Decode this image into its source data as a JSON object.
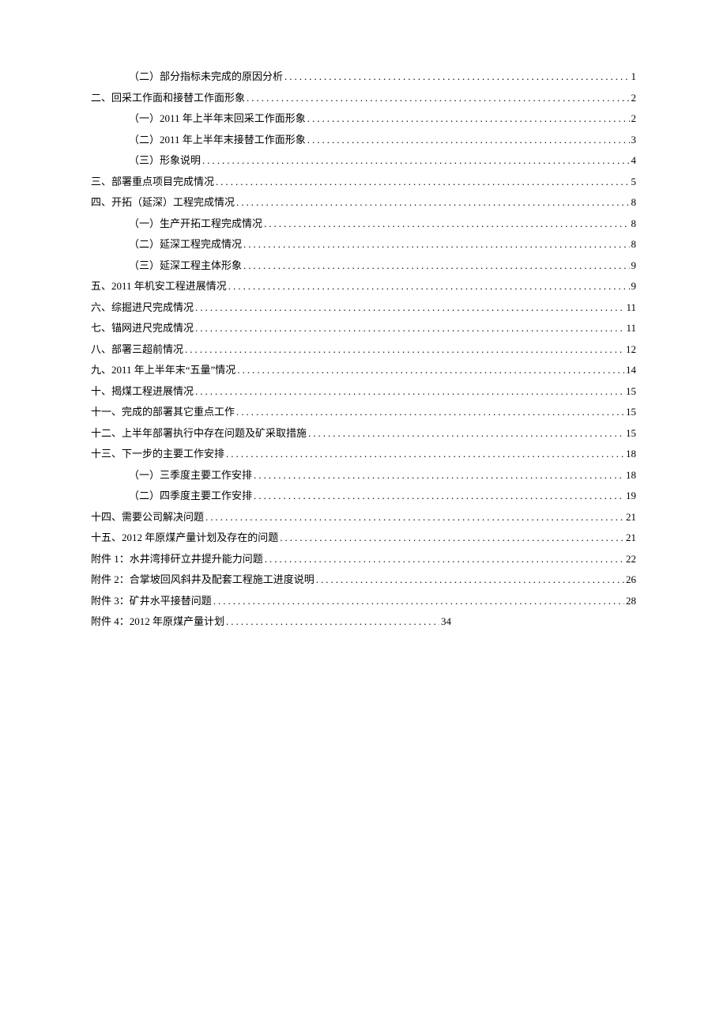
{
  "toc": [
    {
      "level": "nested",
      "title": "（二）部分指标未完成的原因分析",
      "page": "1"
    },
    {
      "level": "top",
      "title": "二、回采工作面和接替工作面形象",
      "page": "2"
    },
    {
      "level": "nested",
      "title": "（一）2011 年上半年末回采工作面形象",
      "page": "2"
    },
    {
      "level": "nested",
      "title": "（二）2011 年上半年末接替工作面形象",
      "page": "3"
    },
    {
      "level": "nested",
      "title": "（三）形象说明",
      "page": "4"
    },
    {
      "level": "top",
      "title": "三、部署重点项目完成情况",
      "page": "5"
    },
    {
      "level": "top",
      "title": "四、开拓（延深）工程完成情况",
      "page": "8"
    },
    {
      "level": "nested",
      "title": "（一）生产开拓工程完成情况",
      "page": "8"
    },
    {
      "level": "nested",
      "title": "（二）延深工程完成情况",
      "page": "8"
    },
    {
      "level": "nested",
      "title": "（三）延深工程主体形象",
      "page": "9"
    },
    {
      "level": "top",
      "title": "五、2011 年机安工程进展情况",
      "page": "9"
    },
    {
      "level": "top",
      "title": "六、综掘进尺完成情况",
      "page": "11"
    },
    {
      "level": "top",
      "title": "七、锚网进尺完成情况",
      "page": "11"
    },
    {
      "level": "top",
      "title": "八、部署三超前情况",
      "page": "12"
    },
    {
      "level": "top",
      "title": "九、2011 年上半年末“五量”情况",
      "page": "14"
    },
    {
      "level": "top",
      "title": "十、揭煤工程进展情况",
      "page": "15"
    },
    {
      "level": "top",
      "title": "十一、完成的部署其它重点工作",
      "page": "15"
    },
    {
      "level": "top",
      "title": "十二、上半年部署执行中存在问题及矿采取措施",
      "page": "15"
    },
    {
      "level": "top",
      "title": "十三、下一步的主要工作安排",
      "page": "18"
    },
    {
      "level": "nested",
      "title": "（一）三季度主要工作安排",
      "page": "18"
    },
    {
      "level": "nested",
      "title": "（二）四季度主要工作安排",
      "page": "19"
    },
    {
      "level": "top",
      "title": "十四、需要公司解决问题",
      "page": "21"
    },
    {
      "level": "top",
      "title": "十五、2012 年原煤产量计划及存在的问题",
      "page": "21"
    },
    {
      "level": "top",
      "title": "附件 1：水井湾排矸立井提升能力问题",
      "page": "22"
    },
    {
      "level": "top",
      "title": "附件 2：合掌坡回风斜井及配套工程施工进度说明",
      "page": "26"
    },
    {
      "level": "top",
      "title": "附件 3：矿井水平接替问题",
      "page": "28"
    },
    {
      "level": "top",
      "title": "附件 4：2012 年原煤产量计划",
      "page": "34",
      "short": true
    }
  ]
}
